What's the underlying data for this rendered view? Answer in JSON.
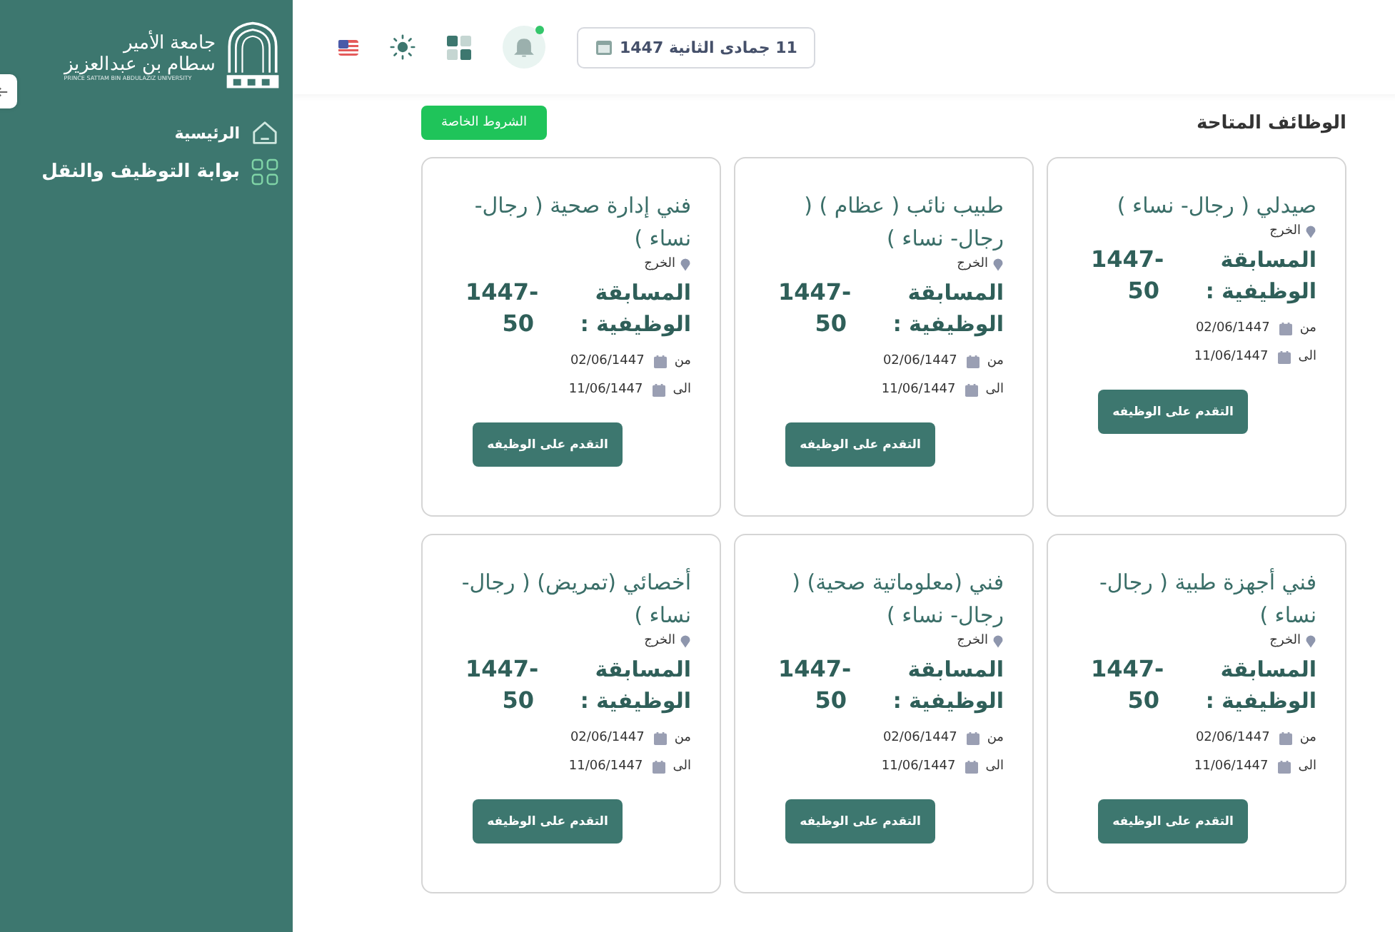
{
  "sidebar": {
    "logo": {
      "line_1": "جامعة الأمير",
      "line_2": "سطام بن عبدالعزيز",
      "line_3": "PRINCE SATTAM BIN ABDULAZIZ UNIVERSITY"
    },
    "items": [
      {
        "label": "الرئيسية",
        "kind": "home",
        "selected": false
      },
      {
        "label": "بوابة التوظيف والنقل",
        "kind": "portal",
        "selected": true
      }
    ]
  },
  "header": {
    "date": "11 جمادى الثانية 1447",
    "notification": true
  },
  "page": {
    "title": "الوظائف المتاحة",
    "terms_button": "الشروط الخاصة"
  },
  "jobs": [
    {
      "title": "صيدلي ( رجال- نساء )",
      "location": "الخرج",
      "competition_label": "المسابقة الوظيفية :",
      "competition_number": "1447-50",
      "from_label": "من",
      "from_date": "02/06/1447",
      "to_label": "الى",
      "to_date": "11/06/1447",
      "button": "التقدم على الوظيفه"
    },
    {
      "title": "طبيب نائب ( عظام ) ( رجال- نساء )",
      "location": "الخرج",
      "competition_label": "المسابقة الوظيفية :",
      "competition_number": "1447-50",
      "from_label": "من",
      "from_date": "02/06/1447",
      "to_label": "الى",
      "to_date": "11/06/1447",
      "button": "التقدم على الوظيفه"
    },
    {
      "title": "فني إدارة صحية ( رجال- نساء )",
      "location": "الخرج",
      "competition_label": "المسابقة الوظيفية :",
      "competition_number": "1447-50",
      "from_label": "من",
      "from_date": "02/06/1447",
      "to_label": "الى",
      "to_date": "11/06/1447",
      "button": "التقدم على الوظيفه"
    },
    {
      "title": "فني أجهزة طبية ( رجال- نساء )",
      "location": "الخرج",
      "competition_label": "المسابقة الوظيفية :",
      "competition_number": "1447-50",
      "from_label": "من",
      "from_date": "02/06/1447",
      "to_label": "الى",
      "to_date": "11/06/1447",
      "button": "التقدم على الوظيفه"
    },
    {
      "title": "فني (معلوماتية صحية) ( رجال- نساء )",
      "location": "الخرج",
      "competition_label": "المسابقة الوظيفية :",
      "competition_number": "1447-50",
      "from_label": "من",
      "from_date": "02/06/1447",
      "to_label": "الى",
      "to_date": "11/06/1447",
      "button": "التقدم على الوظيفه"
    },
    {
      "title": "أخصائي (تمريض) ( رجال- نساء )",
      "location": "الخرج",
      "competition_label": "المسابقة الوظيفية :",
      "competition_number": "1447-50",
      "from_label": "من",
      "from_date": "02/06/1447",
      "to_label": "الى",
      "to_date": "11/06/1447",
      "button": "التقدم على الوظيفه"
    }
  ]
}
